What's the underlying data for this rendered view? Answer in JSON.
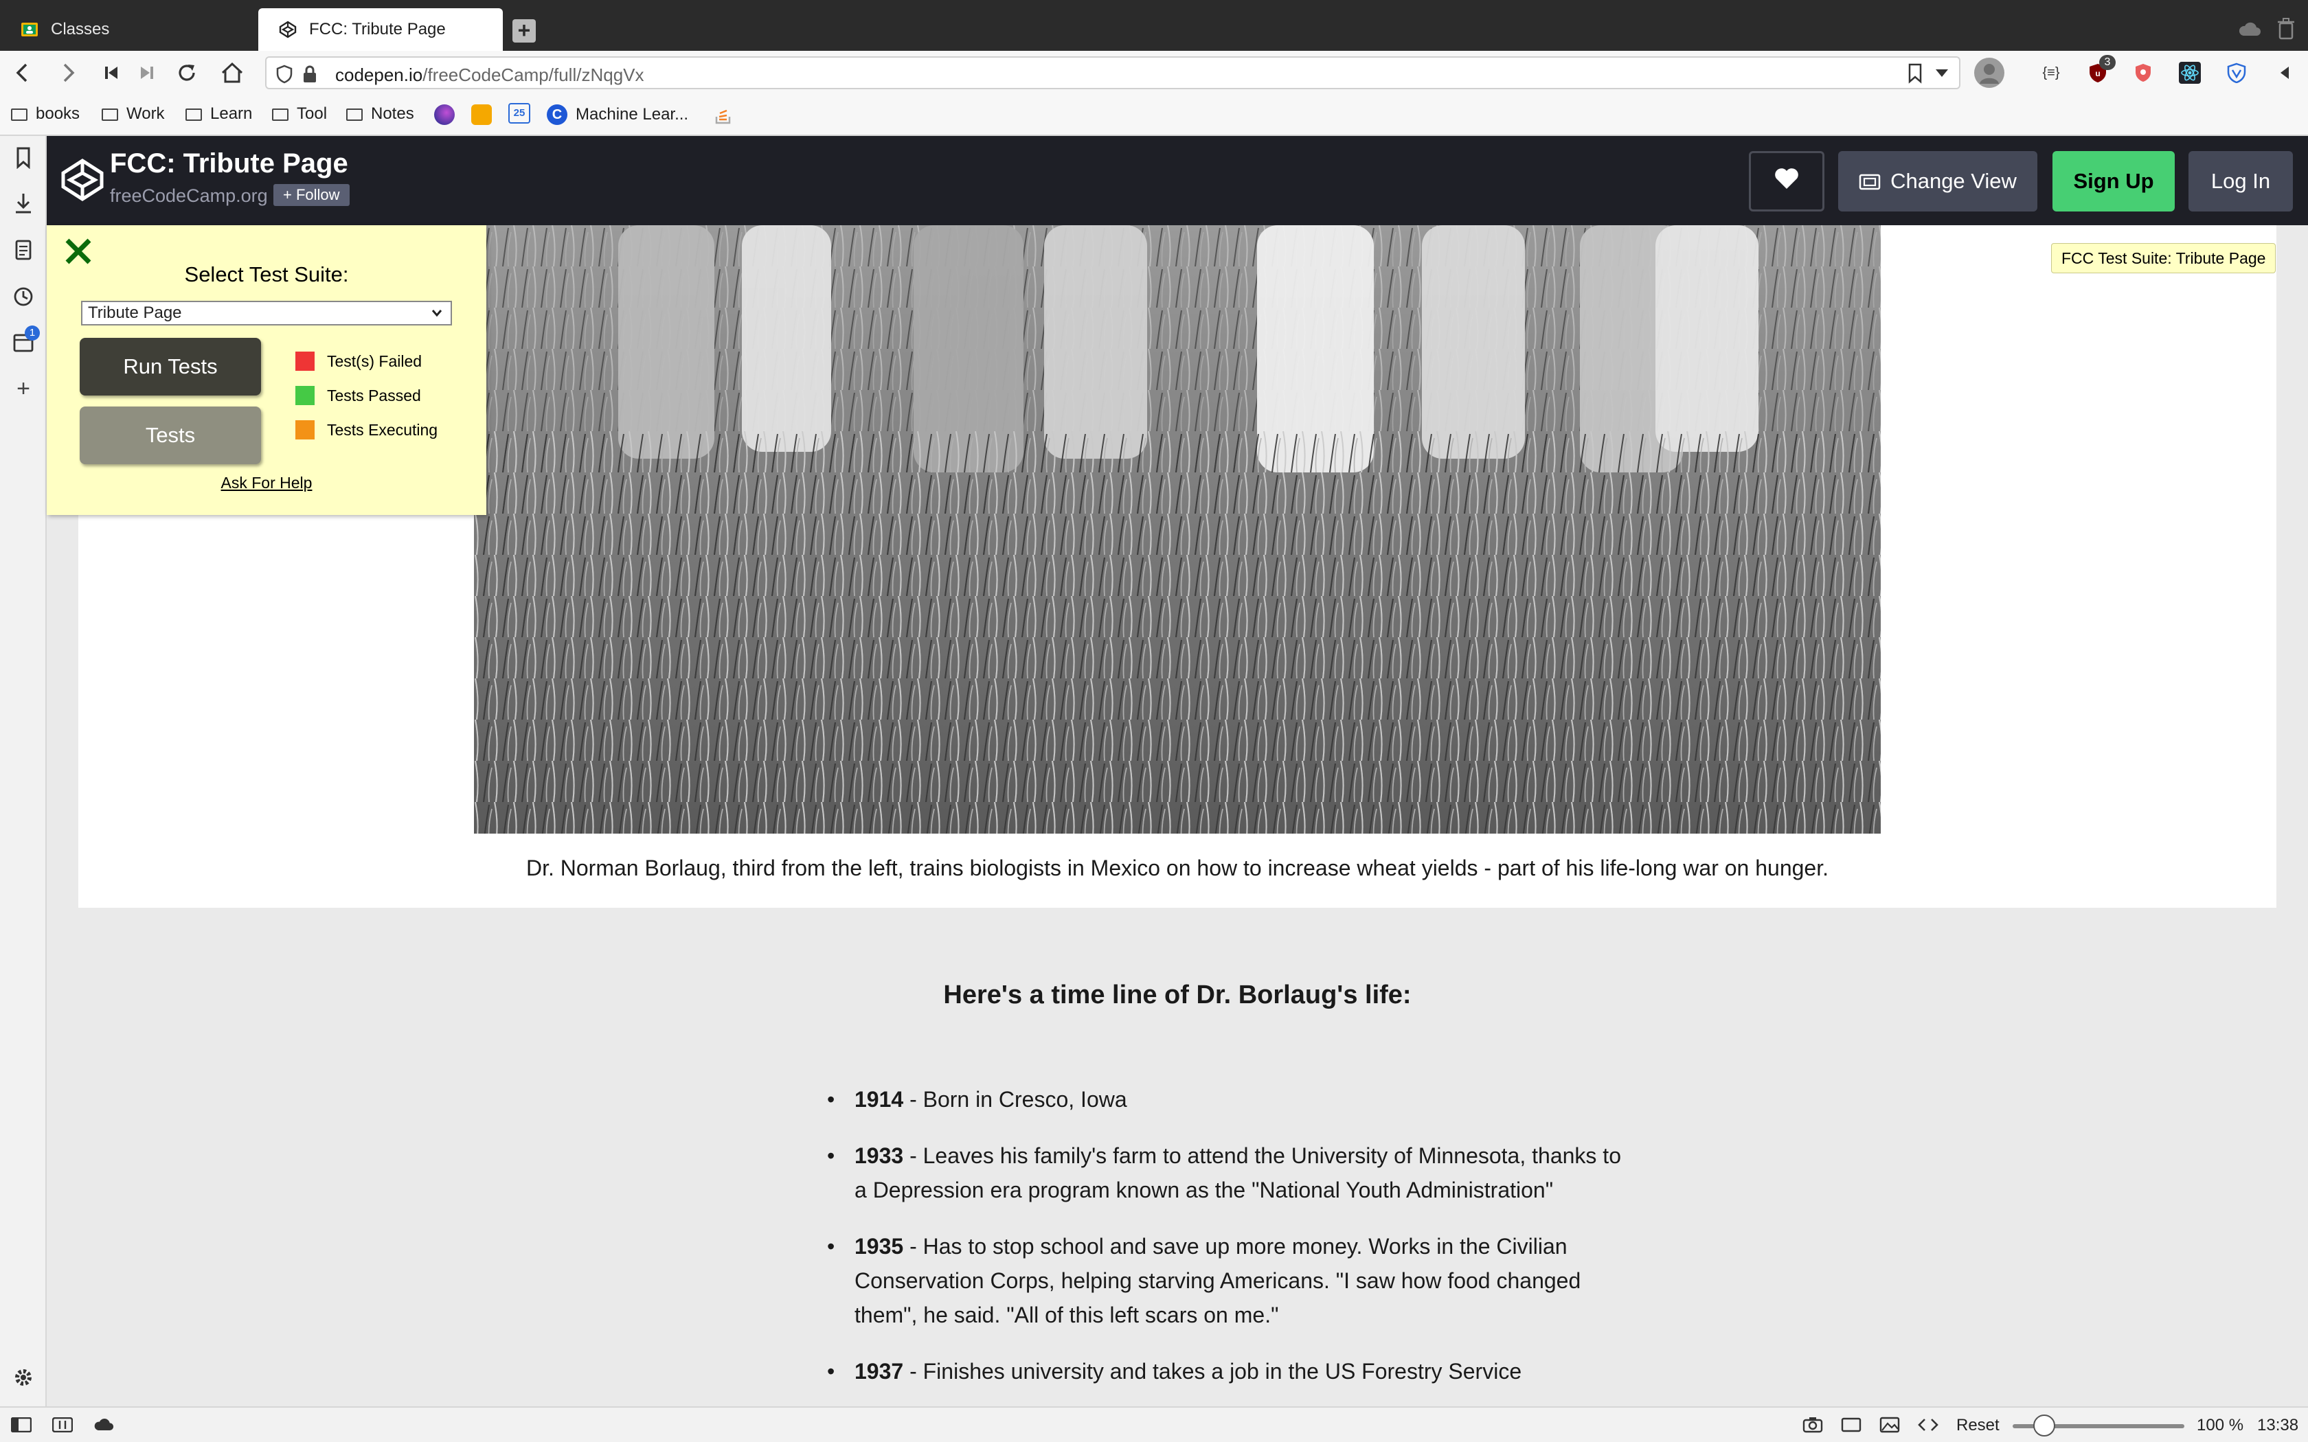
{
  "browser": {
    "tabs": [
      {
        "label": "Classes",
        "icon": "classroom-icon",
        "active": false
      },
      {
        "label": "FCC: Tribute Page",
        "icon": "codepen-icon",
        "active": true
      }
    ],
    "url": {
      "host": "codepen.io",
      "path": "/freeCodeCamp/full/zNqgVx"
    },
    "extension_badge": "3",
    "bookmarks": [
      {
        "label": "books",
        "type": "folder"
      },
      {
        "label": "Work",
        "type": "folder"
      },
      {
        "label": "Learn",
        "type": "folder"
      },
      {
        "label": "Tool",
        "type": "folder"
      },
      {
        "label": "Notes",
        "type": "folder"
      },
      {
        "label": "Machine Lear...",
        "type": "link"
      }
    ],
    "calendar_badge_text": "25",
    "sidebar_badge": "1"
  },
  "codepen": {
    "title": "FCC: Tribute Page",
    "author": "freeCodeCamp.org",
    "follow_label": "+ Follow",
    "change_view_label": "Change View",
    "signup_label": "Sign Up",
    "login_label": "Log In"
  },
  "test_suite": {
    "select_label": "Select Test Suite:",
    "selected_suite": "Tribute Page",
    "run_tests_label": "Run Tests",
    "tests_label": "Tests",
    "legend": [
      {
        "label": "Test(s) Failed",
        "color": "#ee3535"
      },
      {
        "label": "Tests Passed",
        "color": "#45c945"
      },
      {
        "label": "Tests Executing",
        "color": "#f39216"
      }
    ],
    "help_label": "Ask For Help",
    "tooltip": "FCC Test Suite: Tribute Page"
  },
  "page": {
    "caption": "Dr. Norman Borlaug, third from the left, trains biologists in Mexico on how to increase wheat yields - part of his life-long war on hunger.",
    "timeline_heading": "Here's a time line of Dr. Borlaug's life:",
    "timeline": [
      {
        "year": "1914",
        "text": " - Born in Cresco, Iowa"
      },
      {
        "year": "1933",
        "text": " - Leaves his family's farm to attend the University of Minnesota, thanks to a Depression era program known as the \"National Youth Administration\""
      },
      {
        "year": "1935",
        "text": " - Has to stop school and save up more money. Works in the Civilian Conservation Corps, helping starving Americans. \"I saw how food changed them\", he said. \"All of this left scars on me.\""
      },
      {
        "year": "1937",
        "text": " - Finishes university and takes a job in the US Forestry Service"
      }
    ]
  },
  "statusbar": {
    "reset_label": "Reset",
    "zoom": "100 %",
    "time": "13:38"
  }
}
